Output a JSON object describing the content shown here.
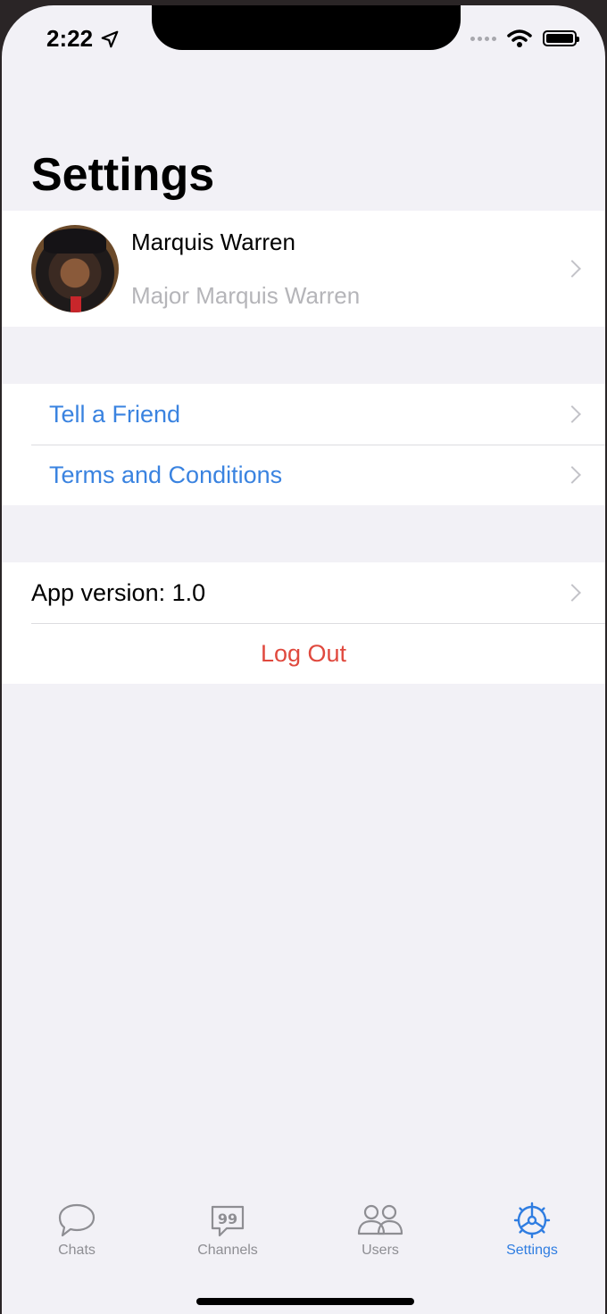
{
  "status_bar": {
    "time": "2:22"
  },
  "header": {
    "title": "Settings"
  },
  "profile": {
    "name": "Marquis Warren",
    "subtitle": "Major Marquis Warren"
  },
  "links": [
    {
      "label": "Tell a Friend"
    },
    {
      "label": "Terms and Conditions"
    }
  ],
  "info": {
    "app_version": "App version: 1.0",
    "logout": "Log Out"
  },
  "tabs": [
    {
      "label": "Chats",
      "icon": "chat-bubble-icon"
    },
    {
      "label": "Channels",
      "icon": "quote-bubble-icon"
    },
    {
      "label": "Users",
      "icon": "users-icon"
    },
    {
      "label": "Settings",
      "icon": "gear-icon",
      "active": true
    }
  ],
  "colors": {
    "accent": "#3a83e0",
    "destructive": "#e0493e",
    "background": "#f2f1f6"
  }
}
